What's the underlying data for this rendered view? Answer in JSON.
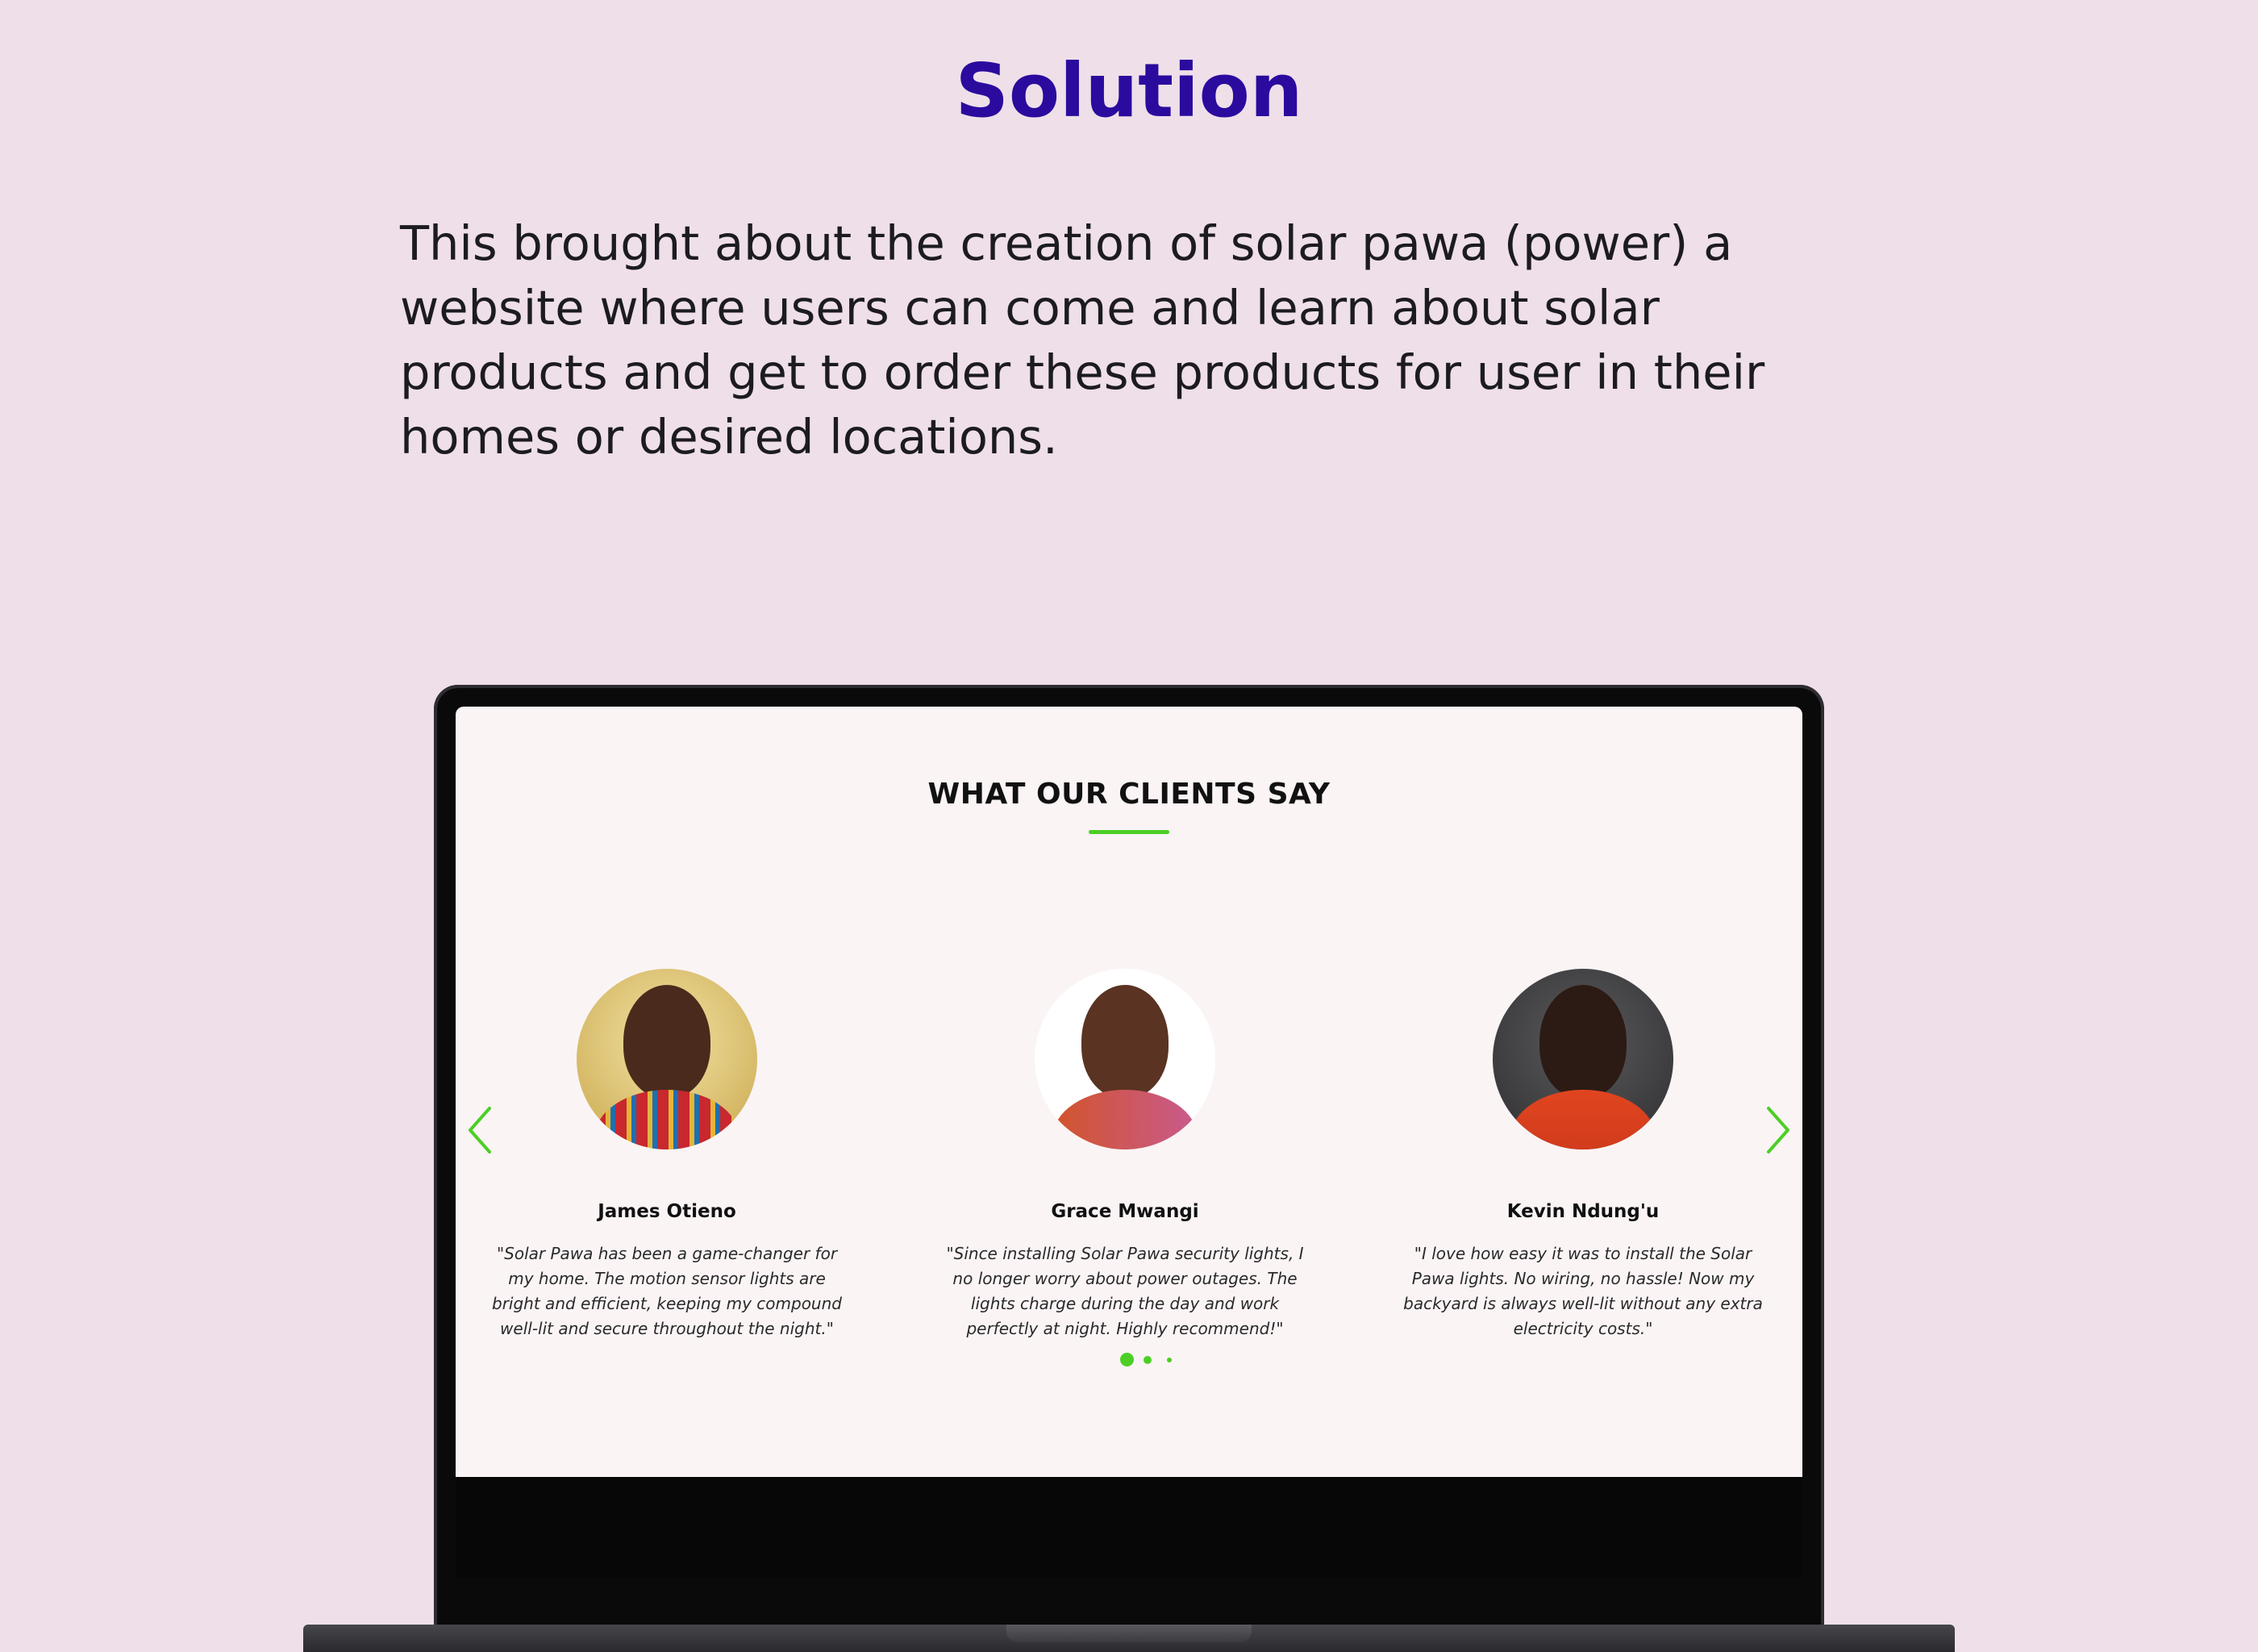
{
  "page": {
    "heading": "Solution",
    "intro": "This brought about the creation of solar pawa (power) a website where users can come and learn about solar products and get to order these products for user in their homes or desired locations."
  },
  "laptop_screen": {
    "section_title": "WHAT OUR CLIENTS SAY",
    "prev_arrow_icon": "chevron-left-icon",
    "next_arrow_icon": "chevron-right-icon",
    "accent_color": "#4ccf25",
    "testimonials": [
      {
        "name": "James Otieno",
        "quote": "\"Solar Pawa has been a game-changer for my home. The motion sensor lights are bright and efficient, keeping my compound well-lit and secure throughout the night.\""
      },
      {
        "name": "Grace Mwangi",
        "quote": "\"Since installing Solar Pawa security lights, I no longer worry about power outages. The lights charge during the day and work perfectly at night. Highly recommend!\""
      },
      {
        "name": "Kevin Ndung'u",
        "quote": "\"I love how easy it was to install the Solar Pawa lights. No wiring, no hassle! Now my backyard is always well-lit without any extra electricity costs.\""
      }
    ],
    "carousel": {
      "pages": 3,
      "active_page": 1
    }
  },
  "colors": {
    "background": "#efdfe9",
    "heading": "#2a0b9e",
    "text": "#1c1b22"
  }
}
